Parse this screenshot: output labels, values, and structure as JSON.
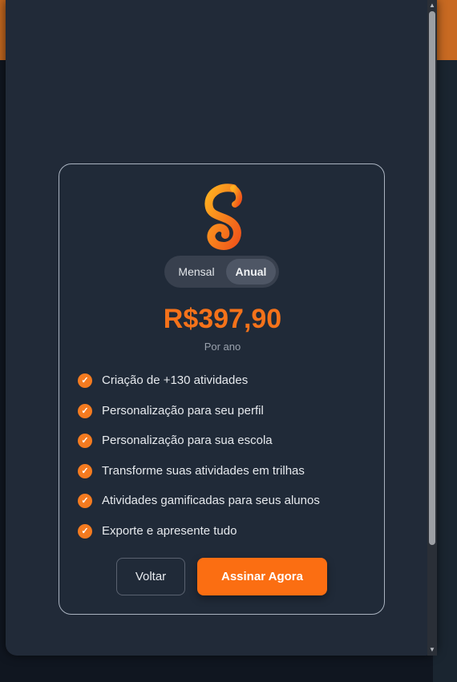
{
  "plan_card": {
    "billing_toggle": {
      "monthly_label": "Mensal",
      "annual_label": "Anual",
      "selected": "Anual"
    },
    "price": "R$397,90",
    "period": "Por ano",
    "features": [
      "Criação de +130 atividades",
      "Personalização para seu perfil",
      "Personalização para sua escola",
      "Transforme suas atividades em trilhas",
      "Atividades gamificadas para seus alunos",
      "Exporte e apresente tudo"
    ],
    "back_label": "Voltar",
    "subscribe_label": "Assinar Agora"
  },
  "icons": {
    "logo": "brand-s-logo-icon",
    "feature": "check-circle-icon"
  },
  "colors": {
    "accent": "#f5721a",
    "button": "#fb6e12",
    "surface": "#212a38"
  }
}
